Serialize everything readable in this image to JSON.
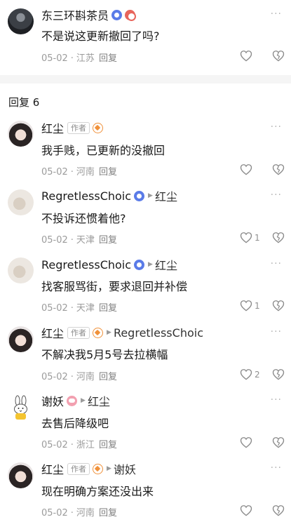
{
  "main_comment": {
    "username": "东三环斟茶员",
    "text": "不是说这更新撤回了吗?",
    "date": "05-02",
    "location": "江苏",
    "reply_label": "回复",
    "more_label": "···"
  },
  "replies_header": "回复 6",
  "replies": [
    {
      "username": "红尘",
      "author_tag": "作者",
      "target": "",
      "text": "我手贱，已更新的没撤回",
      "date": "05-02",
      "location": "河南",
      "reply_label": "回复",
      "likes": ""
    },
    {
      "username": "RegretlessChoic",
      "author_tag": "",
      "target": "红尘",
      "text": "不投诉还惯着他?",
      "date": "05-02",
      "location": "天津",
      "reply_label": "回复",
      "likes": "1"
    },
    {
      "username": "RegretlessChoic",
      "author_tag": "",
      "target": "红尘",
      "text": "找客服骂街，要求退回并补偿",
      "date": "05-02",
      "location": "天津",
      "reply_label": "回复",
      "likes": "1"
    },
    {
      "username": "红尘",
      "author_tag": "作者",
      "target": "RegretlessChoic",
      "text": "不解决我5月5号去拉横幅",
      "date": "05-02",
      "location": "河南",
      "reply_label": "回复",
      "likes": "2"
    },
    {
      "username": "谢妖",
      "author_tag": "",
      "target": "红尘",
      "text": "去售后降级吧",
      "date": "05-02",
      "location": "浙江",
      "reply_label": "回复",
      "likes": ""
    },
    {
      "username": "红尘",
      "author_tag": "作者",
      "target": "谢妖",
      "text": "现在明确方案还没出来",
      "date": "05-02",
      "location": "河南",
      "reply_label": "回复",
      "likes": ""
    }
  ],
  "colors": {
    "accent_blue": "#5a7be8",
    "badge_orange": "#f0913a",
    "muted_text": "#9b9b9b"
  }
}
